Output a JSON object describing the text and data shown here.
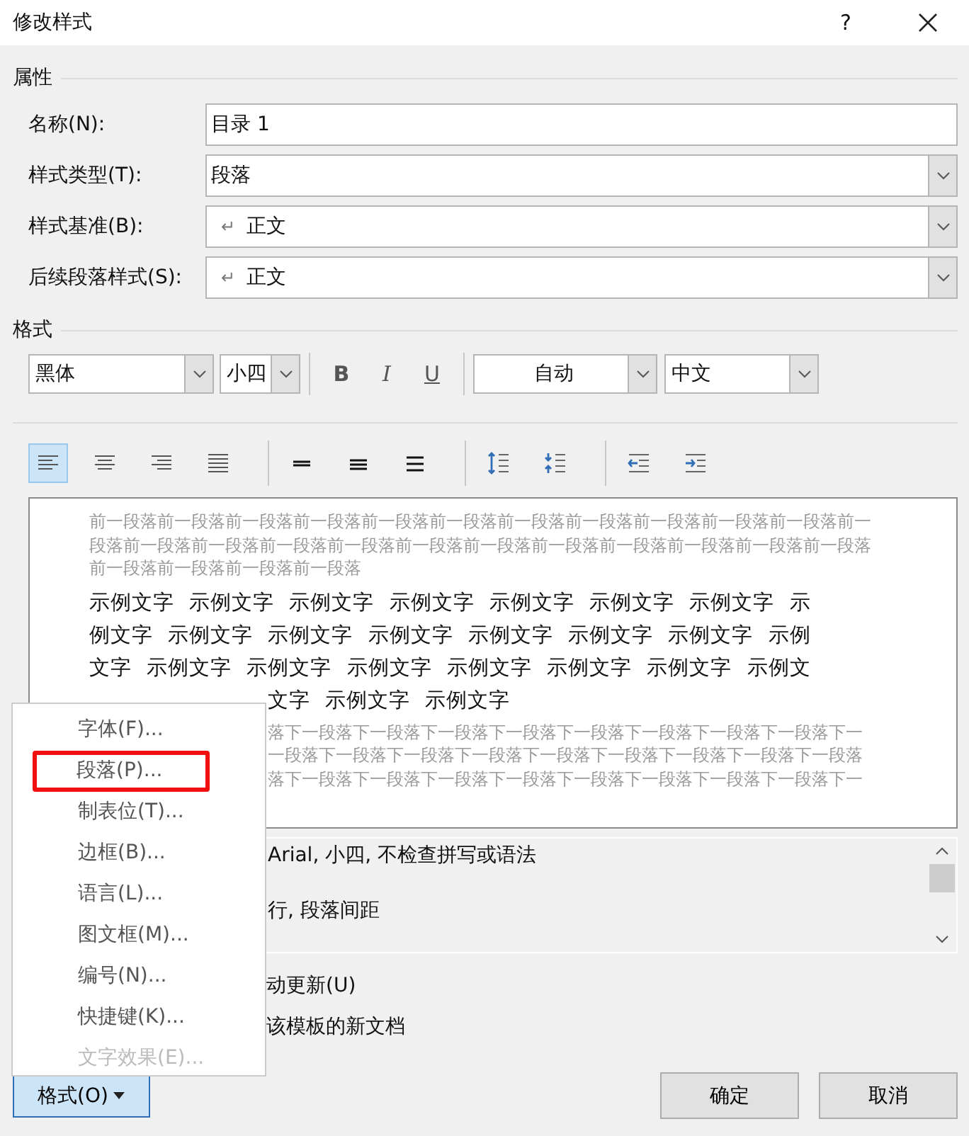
{
  "window": {
    "title": "修改样式",
    "help": "?"
  },
  "properties": {
    "heading": "属性",
    "fields": [
      {
        "label": "名称(N):",
        "value": "目录 1",
        "kind": "text"
      },
      {
        "label": "样式类型(T):",
        "value": "段落",
        "kind": "dropdown"
      },
      {
        "label": "样式基准(B):",
        "mark": "↵",
        "value": "正文",
        "kind": "dropdown"
      },
      {
        "label": "后续段落样式(S):",
        "mark": "↵",
        "value": "正文",
        "kind": "dropdown"
      }
    ]
  },
  "format": {
    "heading": "格式",
    "font": "黑体",
    "size": "小四",
    "bold": "B",
    "italic": "I",
    "underline": "U",
    "font_color": "自动",
    "language": "中文",
    "paragraph_buttons": [
      {
        "kind": "align-left",
        "selected": true
      },
      {
        "kind": "align-center",
        "selected": false
      },
      {
        "kind": "align-right",
        "selected": false
      },
      {
        "kind": "justify",
        "selected": false
      },
      {
        "kind": "single-spacing",
        "selected": false
      },
      {
        "kind": "one-half-spacing",
        "selected": false
      },
      {
        "kind": "double-spacing",
        "selected": false
      },
      {
        "kind": "space-before",
        "selected": false
      },
      {
        "kind": "space-after",
        "selected": false
      },
      {
        "kind": "outdent",
        "selected": false
      },
      {
        "kind": "indent",
        "selected": false
      }
    ]
  },
  "preview": {
    "previous_lines": [
      "前一段落前一段落前一段落前一段落前一段落前一段落前一段落前一段落前一段落前一段落前一段落前一",
      "段落前一段落前一段落前一段落前一段落前一段落前一段落前一段落前一段落前一段落前一段落前一段落",
      "前一段落前一段落前一段落前一段落"
    ],
    "sample_lines": [
      {
        "text": "示例文字 示例文字 示例文字 示例文字 示例文字 示例文字 示例文字 示",
        "partly_covered": false
      },
      {
        "text": "例文字 示例文字 示例文字 示例文字 示例文字 示例文字 示例文字 示例",
        "partly_covered": false
      },
      {
        "text": "文字 示例文字 示例文字 示例文字 示例文字 示例文字 示例文字 示例文",
        "partly_covered": false
      },
      {
        "text": "文字 示例文字 示例文字",
        "partly_covered": true
      }
    ],
    "next_lines": [
      "落下一段落下一段落下一段落下一段落下一段落下一段落下一段落下一段落下一",
      "一段落下一段落下一段落下一段落下一段落下一段落下一段落下一段落下一段落",
      "落下一段落下一段落下一段落下一段落下一段落下一段落下一段落下一段落下一"
    ]
  },
  "description": {
    "lines": [
      "Arial, 小四, 不检查拼写或语法",
      "行, 段落间距"
    ]
  },
  "options": [
    {
      "label": "动更新(U)"
    },
    {
      "label": "该模板的新文档"
    }
  ],
  "menu": {
    "items": [
      {
        "label": "字体(F)...",
        "disabled": false,
        "highlighted": false
      },
      {
        "label": "段落(P)...",
        "disabled": false,
        "highlighted": true
      },
      {
        "label": "制表位(T)...",
        "disabled": false,
        "highlighted": false
      },
      {
        "label": "边框(B)...",
        "disabled": false,
        "highlighted": false
      },
      {
        "label": "语言(L)...",
        "disabled": false,
        "highlighted": false
      },
      {
        "label": "图文框(M)...",
        "disabled": false,
        "highlighted": false
      },
      {
        "label": "编号(N)...",
        "disabled": false,
        "highlighted": false
      },
      {
        "label": "快捷键(K)...",
        "disabled": false,
        "highlighted": false
      },
      {
        "label": "文字效果(E)...",
        "disabled": true,
        "highlighted": false
      }
    ]
  },
  "buttons": {
    "format": "格式(O)",
    "ok": "确定",
    "cancel": "取消"
  }
}
